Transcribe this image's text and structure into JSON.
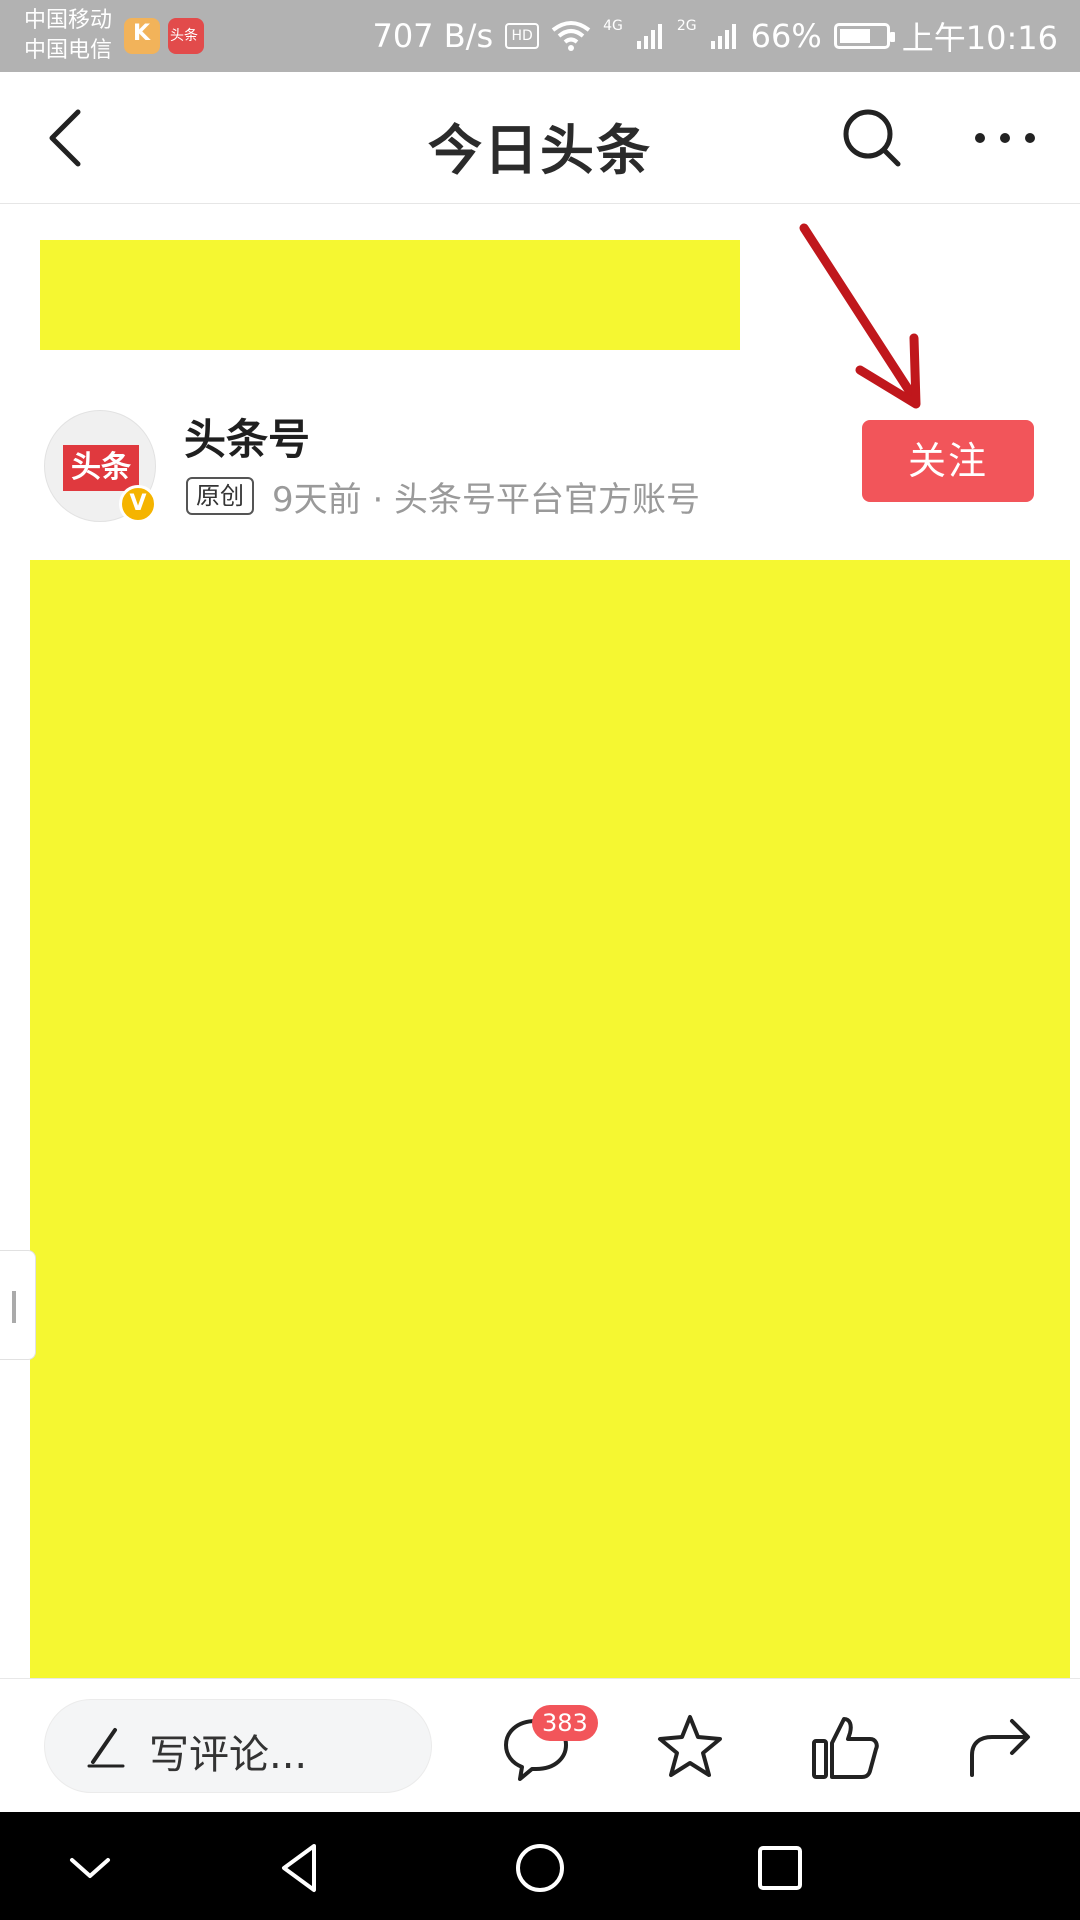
{
  "status_bar": {
    "carrier_1": "中国移动",
    "carrier_2": "中国电信",
    "net_speed": "707 B/s",
    "hd": "HD",
    "net_4g": "4G",
    "net_2g": "2G",
    "battery": "66%",
    "time": "上午10:16"
  },
  "nav": {
    "title": "今日头条",
    "back_icon": "back-arrow-icon",
    "search_icon": "search-icon",
    "more_icon": "more-dots-icon"
  },
  "author": {
    "name": "头条号",
    "avatar_text": "头条",
    "verified_mark": "V",
    "original_badge": "原创",
    "meta": "9天前 · 头条号平台官方账号",
    "follow_label": "关注"
  },
  "actions": {
    "comment_placeholder": "写评论...",
    "comment_count": "383",
    "icons": [
      "comment-icon",
      "star-icon",
      "like-icon",
      "share-icon"
    ]
  },
  "colors": {
    "accent_red": "#f2555a",
    "redaction_yellow": "#f5f731",
    "arrow_red": "#c0171c"
  }
}
